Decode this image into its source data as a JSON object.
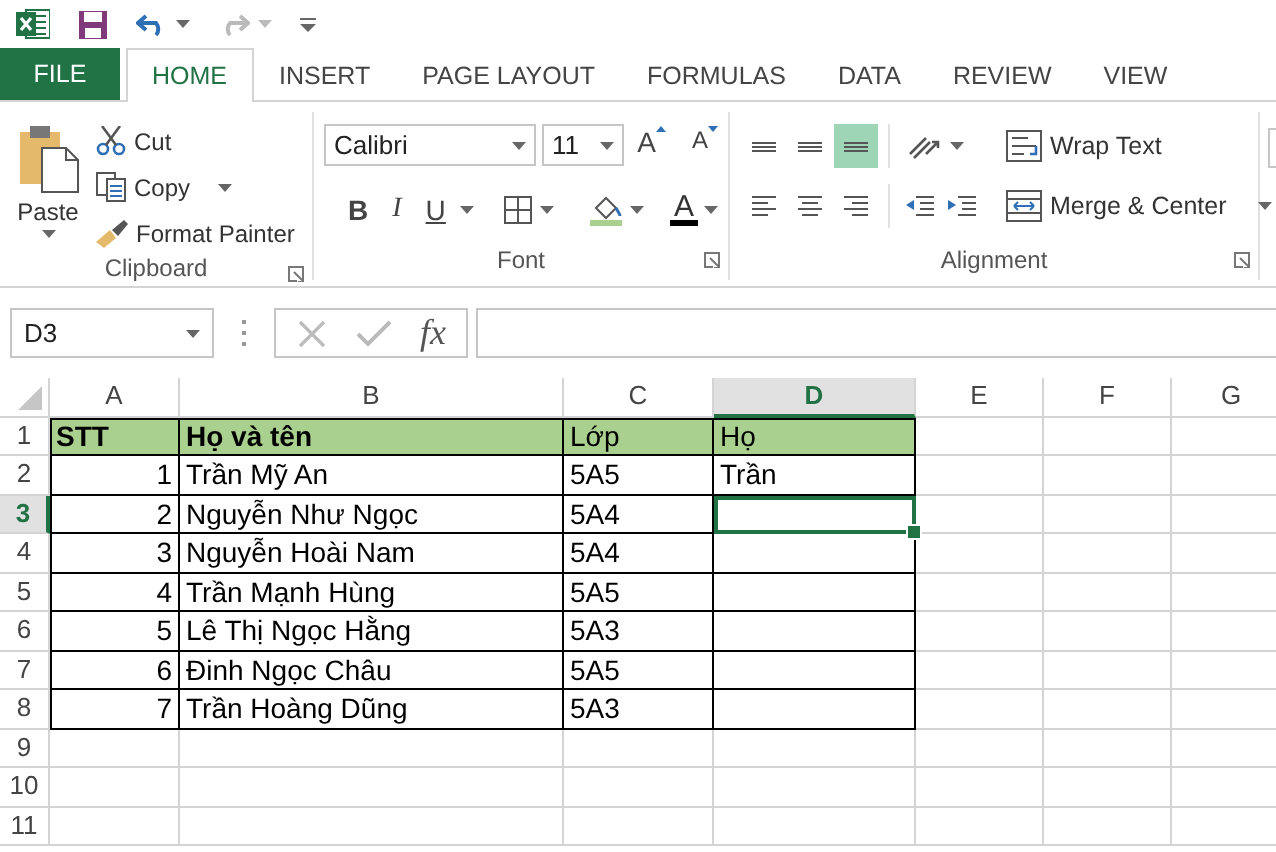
{
  "quick_access_toolbar": {
    "undo_enabled": true,
    "redo_enabled": false
  },
  "file_tab": "FILE",
  "tabs": [
    {
      "label": "HOME",
      "selected": true
    },
    {
      "label": "INSERT",
      "selected": false
    },
    {
      "label": "PAGE LAYOUT",
      "selected": false
    },
    {
      "label": "FORMULAS",
      "selected": false
    },
    {
      "label": "DATA",
      "selected": false
    },
    {
      "label": "REVIEW",
      "selected": false
    },
    {
      "label": "VIEW",
      "selected": false
    }
  ],
  "ribbon": {
    "clipboard": {
      "paste": "Paste",
      "cut": "Cut",
      "copy": "Copy",
      "format_painter": "Format Painter",
      "label": "Clipboard"
    },
    "font": {
      "font_name": "Calibri",
      "font_size": "11",
      "grow_font": "A",
      "shrink_font": "A",
      "bold": "B",
      "italic": "I",
      "underline": "U",
      "font_color": "A",
      "label": "Font"
    },
    "alignment": {
      "vertical_align": [
        {
          "selected": false
        },
        {
          "selected": false
        },
        {
          "selected": true
        }
      ],
      "wrap_text": "Wrap Text",
      "merge_center": "Merge & Center",
      "label": "Alignment"
    }
  },
  "formula_bar": {
    "name_box": "D3",
    "function_button": "fx"
  },
  "sheet": {
    "columns": [
      {
        "label": "A",
        "selected": false
      },
      {
        "label": "B",
        "selected": false
      },
      {
        "label": "C",
        "selected": false
      },
      {
        "label": "D",
        "selected": true
      },
      {
        "label": "E",
        "selected": false
      },
      {
        "label": "F",
        "selected": false
      },
      {
        "label": "G",
        "selected": false
      }
    ],
    "rows": [
      {
        "number": "1",
        "selected": false,
        "kind": "header",
        "cells": [
          {
            "text": "STT",
            "bold": true,
            "kind": "text"
          },
          {
            "text": "Họ và tên",
            "bold": true,
            "kind": "text"
          },
          {
            "text": "Lớp",
            "bold": false,
            "kind": "text"
          },
          {
            "text": "Họ",
            "bold": false,
            "kind": "text"
          }
        ]
      },
      {
        "number": "2",
        "selected": false,
        "kind": "data",
        "cells": [
          {
            "text": "1",
            "bold": false,
            "kind": "number"
          },
          {
            "text": "Trần Mỹ An",
            "bold": false,
            "kind": "text"
          },
          {
            "text": "5A5",
            "bold": false,
            "kind": "text"
          },
          {
            "text": "Trần",
            "bold": false,
            "kind": "text"
          }
        ]
      },
      {
        "number": "3",
        "selected": true,
        "kind": "data",
        "cells": [
          {
            "text": "2",
            "bold": false,
            "kind": "number"
          },
          {
            "text": "Nguyễn Như Ngọc",
            "bold": false,
            "kind": "text"
          },
          {
            "text": "5A4",
            "bold": false,
            "kind": "text"
          }
        ]
      },
      {
        "number": "4",
        "selected": false,
        "kind": "data",
        "cells": [
          {
            "text": "3",
            "bold": false,
            "kind": "number"
          },
          {
            "text": "Nguyễn Hoài Nam",
            "bold": false,
            "kind": "text"
          },
          {
            "text": "5A4",
            "bold": false,
            "kind": "text"
          }
        ]
      },
      {
        "number": "5",
        "selected": false,
        "kind": "data",
        "cells": [
          {
            "text": "4",
            "bold": false,
            "kind": "number"
          },
          {
            "text": "Trần Mạnh Hùng",
            "bold": false,
            "kind": "text"
          },
          {
            "text": "5A5",
            "bold": false,
            "kind": "text"
          }
        ]
      },
      {
        "number": "6",
        "selected": false,
        "kind": "data",
        "cells": [
          {
            "text": "5",
            "bold": false,
            "kind": "number"
          },
          {
            "text": "Lê Thị Ngọc Hằng",
            "bold": false,
            "kind": "text"
          },
          {
            "text": "5A3",
            "bold": false,
            "kind": "text"
          }
        ]
      },
      {
        "number": "7",
        "selected": false,
        "kind": "data",
        "cells": [
          {
            "text": "6",
            "bold": false,
            "kind": "number"
          },
          {
            "text": "Đinh Ngọc Châu",
            "bold": false,
            "kind": "text"
          },
          {
            "text": "5A5",
            "bold": false,
            "kind": "text"
          }
        ]
      },
      {
        "number": "8",
        "selected": false,
        "kind": "data",
        "cells": [
          {
            "text": "7",
            "bold": false,
            "kind": "number"
          },
          {
            "text": "Trần Hoàng Dũng",
            "bold": false,
            "kind": "text"
          },
          {
            "text": "5A3",
            "bold": false,
            "kind": "text"
          }
        ]
      },
      {
        "number": "9",
        "selected": false,
        "kind": "empty",
        "cells": []
      },
      {
        "number": "10",
        "selected": false,
        "kind": "empty",
        "cells": []
      },
      {
        "number": "11",
        "selected": false,
        "kind": "empty",
        "cells": []
      }
    ]
  }
}
